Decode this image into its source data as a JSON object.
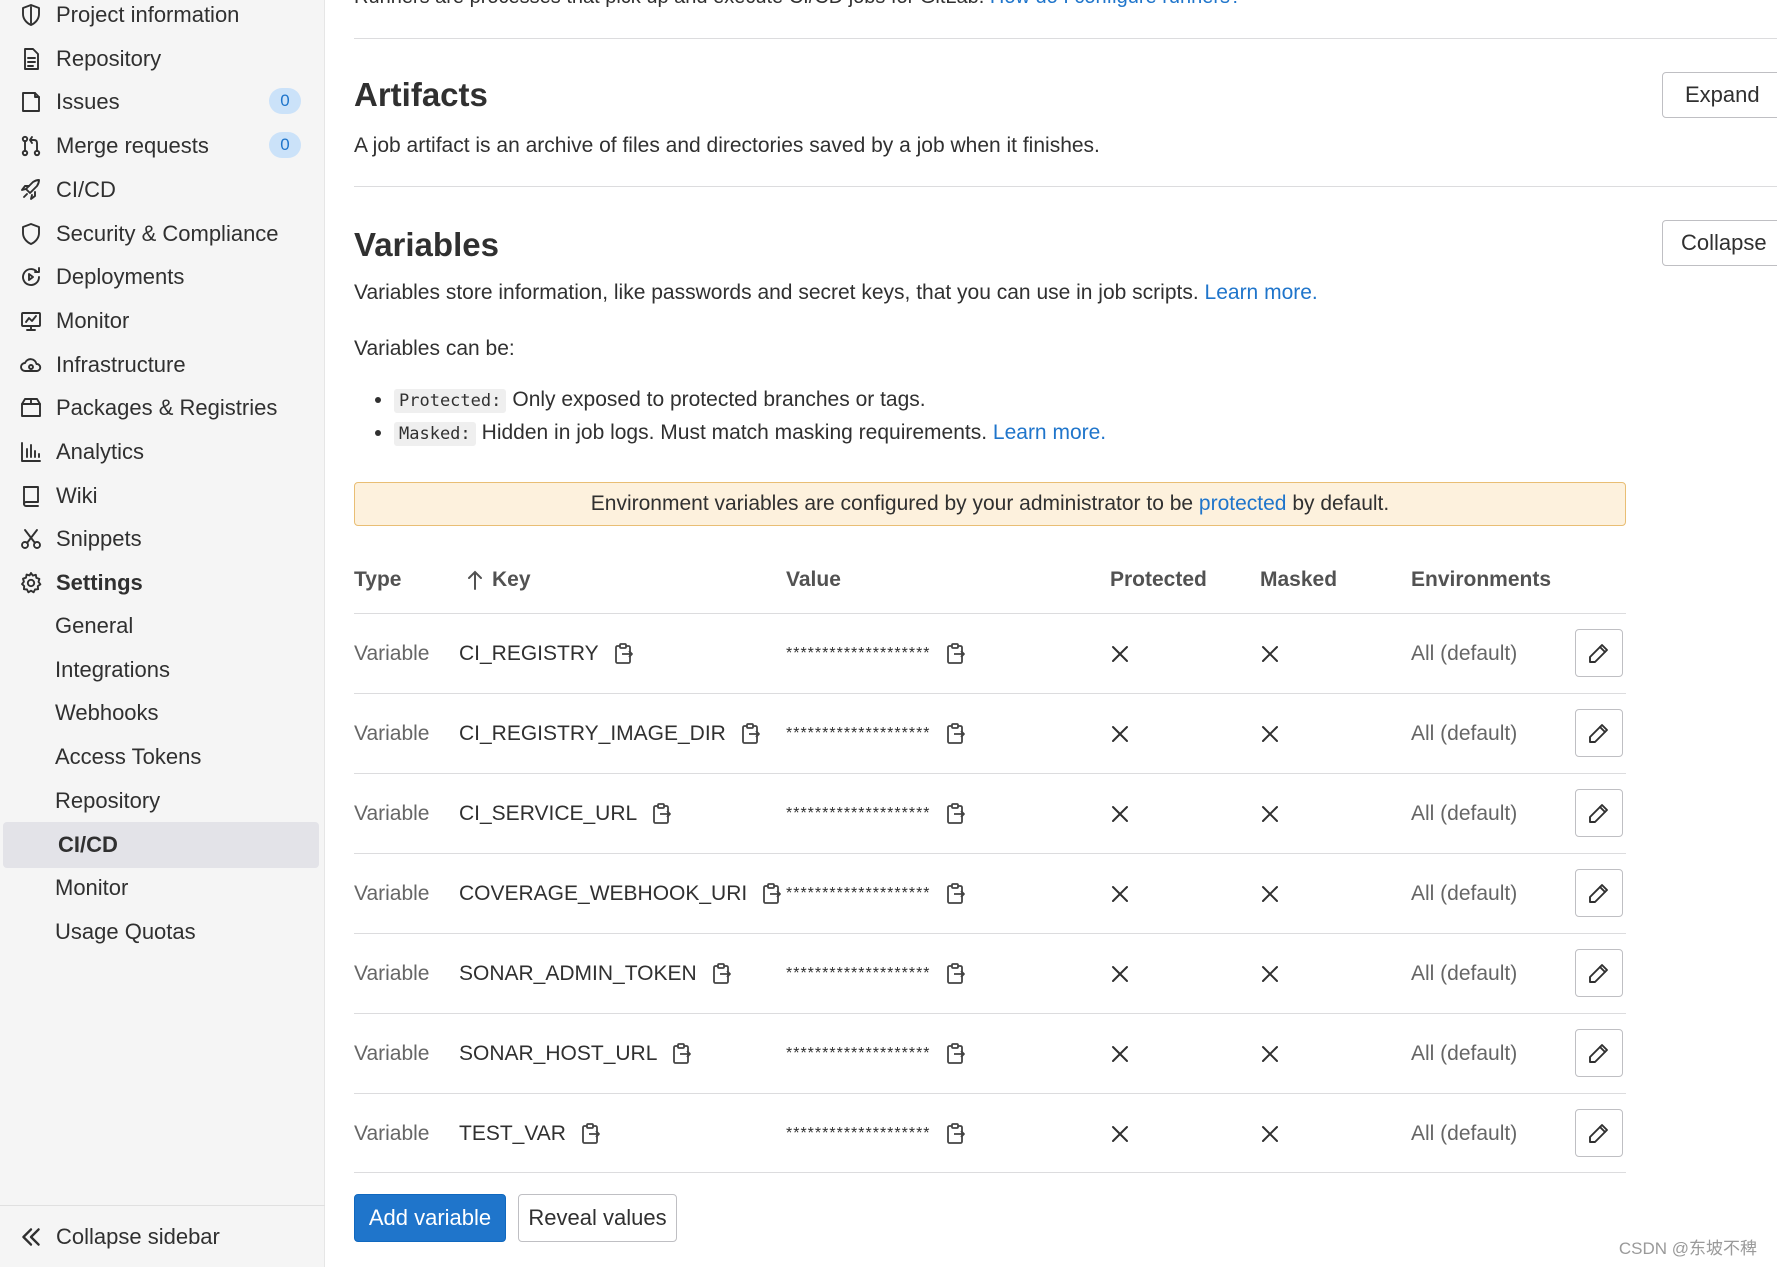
{
  "sidebar": {
    "items": [
      {
        "label": "Project information",
        "icon": "info-shield-icon"
      },
      {
        "label": "Repository",
        "icon": "document-icon"
      },
      {
        "label": "Issues",
        "icon": "issues-icon",
        "badge": "0"
      },
      {
        "label": "Merge requests",
        "icon": "merge-request-icon",
        "badge": "0"
      },
      {
        "label": "CI/CD",
        "icon": "rocket-icon"
      },
      {
        "label": "Security & Compliance",
        "icon": "shield-icon"
      },
      {
        "label": "Deployments",
        "icon": "deployments-icon"
      },
      {
        "label": "Monitor",
        "icon": "monitor-icon"
      },
      {
        "label": "Infrastructure",
        "icon": "cloud-gear-icon"
      },
      {
        "label": "Packages & Registries",
        "icon": "package-icon"
      },
      {
        "label": "Analytics",
        "icon": "chart-icon"
      },
      {
        "label": "Wiki",
        "icon": "book-icon"
      },
      {
        "label": "Snippets",
        "icon": "scissors-icon"
      },
      {
        "label": "Settings",
        "icon": "gear-icon"
      }
    ],
    "settings_sub": [
      {
        "label": "General"
      },
      {
        "label": "Integrations"
      },
      {
        "label": "Webhooks"
      },
      {
        "label": "Access Tokens"
      },
      {
        "label": "Repository"
      },
      {
        "label": "CI/CD",
        "active": true
      },
      {
        "label": "Monitor"
      },
      {
        "label": "Usage Quotas"
      }
    ],
    "collapse_label": "Collapse sidebar"
  },
  "runners": {
    "text": "Runners are processes that pick up and execute CI/CD jobs for GitLab.",
    "link": "How do I configure runners?"
  },
  "artifacts": {
    "title": "Artifacts",
    "description": "A job artifact is an archive of files and directories saved by a job when it finishes.",
    "button": "Expand"
  },
  "variables": {
    "title": "Variables",
    "description": "Variables store information, like passwords and secret keys, that you can use in job scripts.",
    "description_link": "Learn more.",
    "button": "Collapse",
    "can_be": "Variables can be:",
    "bullets": [
      {
        "tag": "Protected:",
        "text": "Only exposed to protected branches or tags.",
        "link": ""
      },
      {
        "tag": "Masked:",
        "text": "Hidden in job logs. Must match masking requirements.",
        "link": "Learn more."
      }
    ],
    "alert": {
      "before": "Environment variables are configured by your administrator to be",
      "link": "protected",
      "after": "by default."
    },
    "columns": {
      "type": "Type",
      "key": "Key",
      "value": "Value",
      "protected": "Protected",
      "masked": "Masked",
      "environments": "Environments"
    },
    "rows": [
      {
        "type": "Variable",
        "key": "CI_REGISTRY",
        "value": "********************",
        "env": "All (default)"
      },
      {
        "type": "Variable",
        "key": "CI_REGISTRY_IMAGE_DIR",
        "value": "********************",
        "env": "All (default)"
      },
      {
        "type": "Variable",
        "key": "CI_SERVICE_URL",
        "value": "********************",
        "env": "All (default)"
      },
      {
        "type": "Variable",
        "key": "COVERAGE_WEBHOOK_URI",
        "value": "********************",
        "env": "All (default)"
      },
      {
        "type": "Variable",
        "key": "SONAR_ADMIN_TOKEN",
        "value": "********************",
        "env": "All (default)"
      },
      {
        "type": "Variable",
        "key": "SONAR_HOST_URL",
        "value": "********************",
        "env": "All (default)"
      },
      {
        "type": "Variable",
        "key": "TEST_VAR",
        "value": "********************",
        "env": "All (default)"
      }
    ],
    "add_button": "Add variable",
    "reveal_button": "Reveal values"
  },
  "watermark": "CSDN @东坡不稗",
  "colors": {
    "accent": "#1f75cb",
    "alert_bg": "#fdf1dd",
    "alert_border": "#e9be74"
  }
}
